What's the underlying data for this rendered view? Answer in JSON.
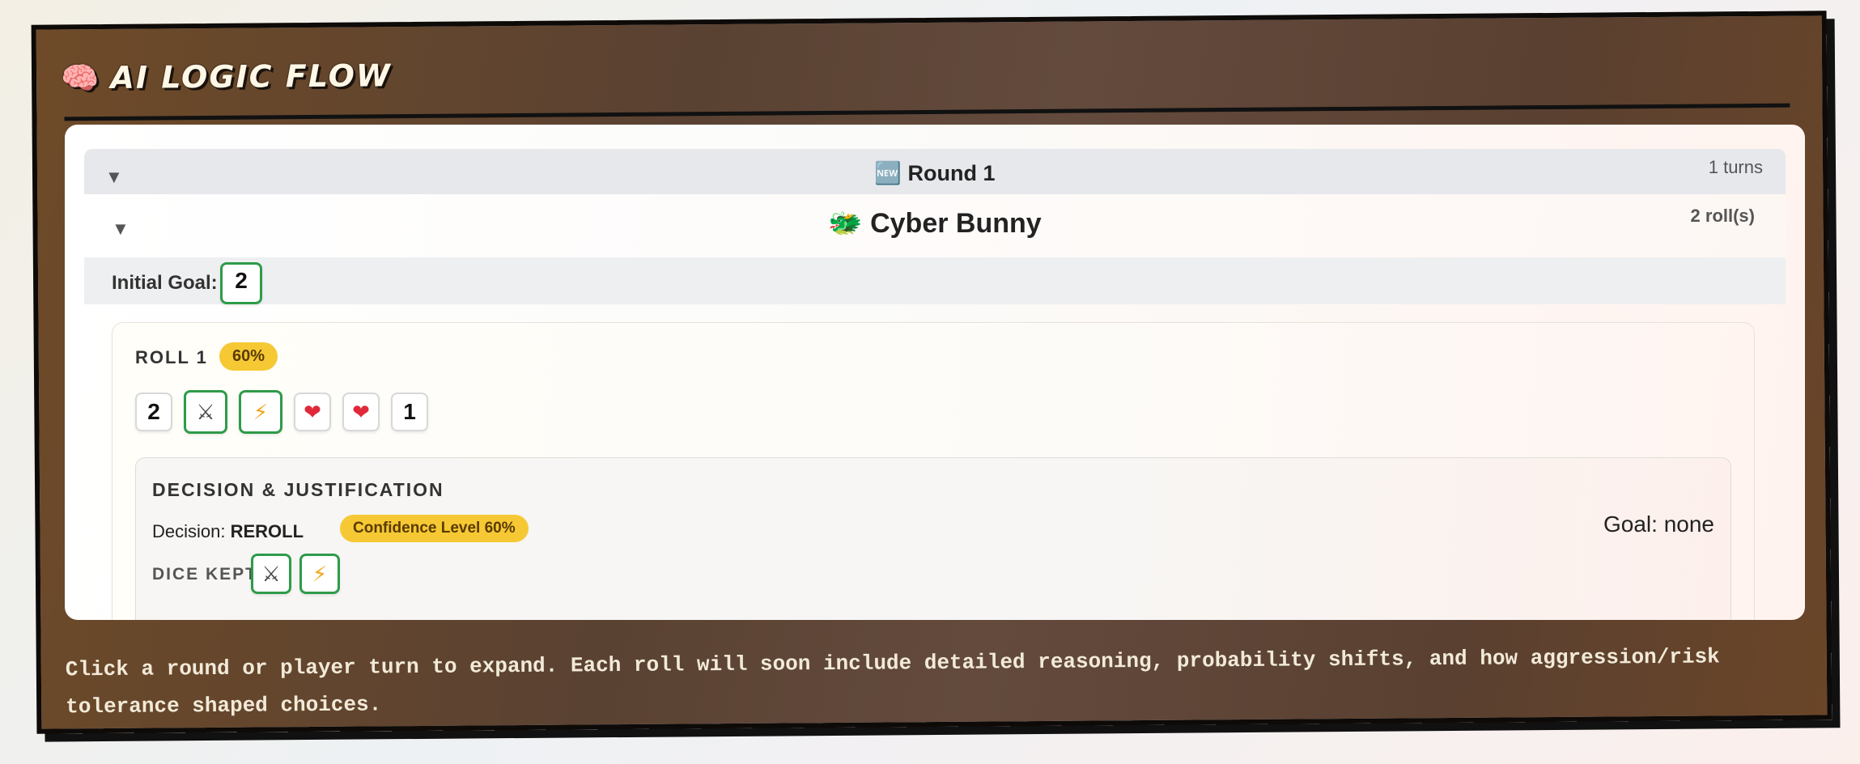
{
  "panel": {
    "title_icon": "🧠",
    "title": "AI LOGIC FLOW",
    "footer": "Click a round or player turn to expand. Each roll will soon include detailed reasoning, probability shifts, and how aggression/risk tolerance shaped choices."
  },
  "round": {
    "icon": "🆕",
    "title": "Round 1",
    "turns": "1 turns"
  },
  "player": {
    "icon": "🐲",
    "name": "Cyber Bunny",
    "rolls": "2 roll(s)",
    "initial_goal_label": "Initial Goal:",
    "initial_goal": "2"
  },
  "roll": {
    "label": "ROLL 1",
    "confidence": "60%",
    "dice": [
      {
        "face": "2",
        "kept": false,
        "icon": ""
      },
      {
        "face": "⚔",
        "kept": true,
        "icon": "crossed-swords-icon"
      },
      {
        "face": "⚡",
        "kept": true,
        "icon": "lightning-icon"
      },
      {
        "face": "❤",
        "kept": false,
        "icon": "heart-icon"
      },
      {
        "face": "❤",
        "kept": false,
        "icon": "heart-icon"
      },
      {
        "face": "1",
        "kept": false,
        "icon": ""
      }
    ],
    "decision": {
      "title": "DECISION & JUSTIFICATION",
      "label": "Decision:",
      "value": "REROLL",
      "confidence_pill": "Confidence Level 60%",
      "goal": "Goal: none",
      "kept_label": "DICE KEPT:",
      "kept": [
        {
          "face": "⚔",
          "icon": "crossed-swords-icon"
        },
        {
          "face": "⚡",
          "icon": "lightning-icon"
        }
      ]
    }
  },
  "colors": {
    "panel_brown": "#5f4533",
    "kept_border": "#2e9b4a",
    "pill_yellow": "#f6c934",
    "heart": "#e0283a",
    "bolt": "#f2a516"
  }
}
